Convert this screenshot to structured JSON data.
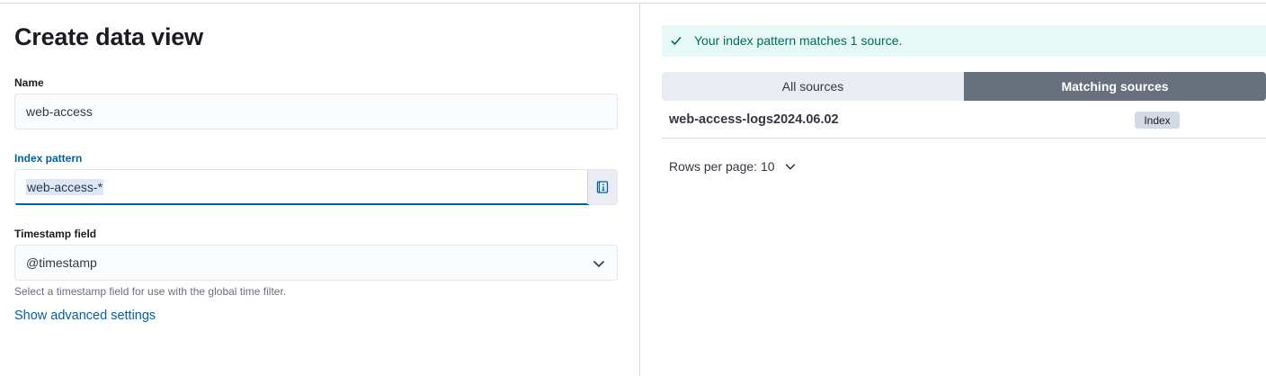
{
  "left": {
    "title": "Create data view",
    "name_field": {
      "label": "Name",
      "value": "web-access"
    },
    "index_pattern": {
      "label": "Index pattern",
      "value": "web-access-*"
    },
    "timestamp_field": {
      "label": "Timestamp field",
      "value": "@timestamp",
      "help": "Select a timestamp field for use with the global time filter."
    },
    "advanced_link": "Show advanced settings"
  },
  "right": {
    "callout": "Your index pattern matches 1 source.",
    "tabs": [
      {
        "label": "All sources",
        "selected": false
      },
      {
        "label": "Matching sources",
        "selected": true
      }
    ],
    "rows": [
      {
        "name": "web-access-logs2024.06.02",
        "type": "Index"
      }
    ],
    "pagination": {
      "label": "Rows per page: 10"
    }
  },
  "icons": {
    "append": "index-help-icon",
    "chevron": "chevron-down-icon",
    "callout": "check-icon"
  },
  "colors": {
    "link": "#0061a6",
    "success": "#006b59",
    "success_bg": "#e6f9f7",
    "tab_selected_bg": "#69707d"
  }
}
